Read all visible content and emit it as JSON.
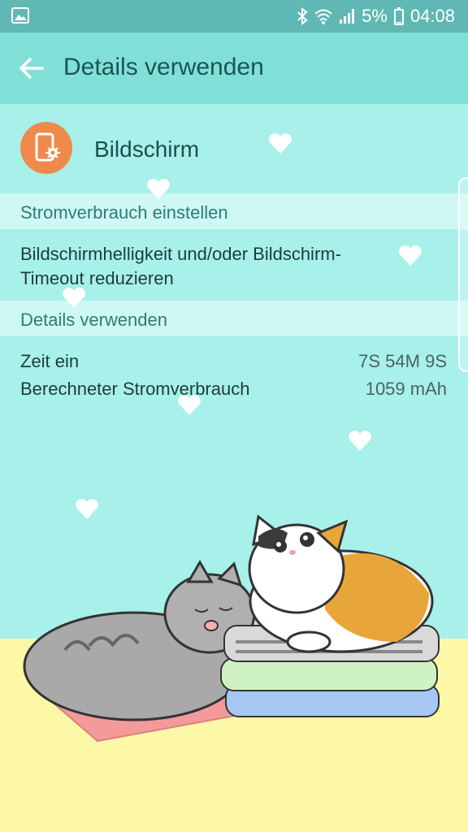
{
  "statusbar": {
    "battery_percent": "5%",
    "time": "04:08",
    "icons": [
      "gallery-icon",
      "bluetooth-icon",
      "wifi-icon",
      "signal-icon",
      "battery-icon"
    ]
  },
  "appbar": {
    "title": "Details verwenden"
  },
  "app": {
    "name": "Bildschirm",
    "icon": "screen-settings-icon",
    "icon_color": "#ef8a4c"
  },
  "sections": {
    "power": {
      "header": "Stromverbrauch einstellen",
      "tip": "Bildschirmhelligkeit und/oder Bildschirm-Timeout reduzieren"
    },
    "details": {
      "header": "Details verwenden",
      "rows": [
        {
          "label": "Zeit ein",
          "value": "7S 54M 9S"
        },
        {
          "label": "Berechneter Stromverbrauch",
          "value": "1059 mAh"
        }
      ]
    }
  },
  "colors": {
    "accent": "#80e0d8",
    "statusbar": "#5fb8b3",
    "background": "#a8f0ea"
  }
}
